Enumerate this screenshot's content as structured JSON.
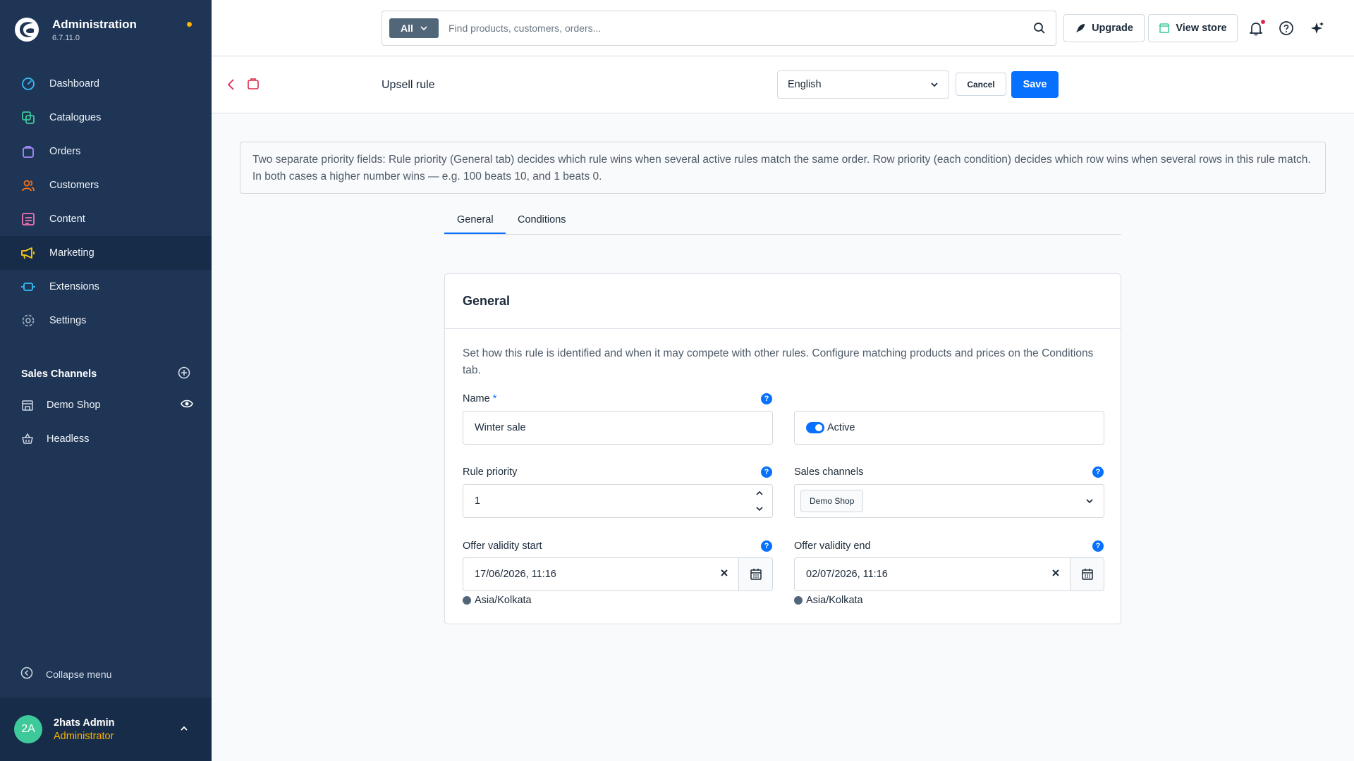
{
  "app": {
    "title": "Administration",
    "version": "6.7.11.0"
  },
  "sidebar": {
    "items": [
      {
        "label": "Dashboard",
        "icon": "dashboard-icon",
        "color": "#38bdf8"
      },
      {
        "label": "Catalogues",
        "icon": "catalogues-icon",
        "color": "#3ec99a"
      },
      {
        "label": "Orders",
        "icon": "orders-icon",
        "color": "#a78bfa"
      },
      {
        "label": "Customers",
        "icon": "customers-icon",
        "color": "#f97316"
      },
      {
        "label": "Content",
        "icon": "content-icon",
        "color": "#f472b6"
      },
      {
        "label": "Marketing",
        "icon": "marketing-icon",
        "color": "#facc15"
      },
      {
        "label": "Extensions",
        "icon": "extensions-icon",
        "color": "#38bdf8"
      },
      {
        "label": "Settings",
        "icon": "settings-icon",
        "color": "#9aa7b8"
      }
    ],
    "active": "Marketing",
    "sales_channels_title": "Sales Channels",
    "sales_channels": [
      {
        "label": "Demo Shop",
        "icon": "storefront-icon"
      },
      {
        "label": "Headless",
        "icon": "basket-icon"
      }
    ],
    "collapse_label": "Collapse menu"
  },
  "user": {
    "initials": "2A",
    "name": "2hats Admin",
    "role": "Administrator"
  },
  "topbar": {
    "search_type": "All",
    "search_placeholder": "Find products, customers, orders...",
    "upgrade_label": "Upgrade",
    "view_store_label": "View store"
  },
  "page": {
    "title": "Upsell rule",
    "language": "English",
    "cancel_label": "Cancel",
    "save_label": "Save"
  },
  "info_text": "Two separate priority fields: Rule priority (General tab) decides which rule wins when several active rules match the same order. Row priority (each condition) decides which row wins when several rows in this rule match. In both cases a higher number wins — e.g. 100 beats 10, and 1 beats 0.",
  "tabs": [
    "General",
    "Conditions"
  ],
  "active_tab": "General",
  "card": {
    "title": "General",
    "description": "Set how this rule is identified and when it may compete with other rules. Configure matching products and prices on the Conditions tab.",
    "name_label": "Name",
    "required_mark": "*",
    "name_value": "Winter sale",
    "active_label": "Active",
    "active_on": true,
    "priority_label": "Rule priority",
    "priority_value": "1",
    "channels_label": "Sales channels",
    "channels_selected": "Demo Shop",
    "start_label": "Offer validity start",
    "start_value": "17/06/2026, 11:16",
    "end_label": "Offer validity end",
    "end_value": "02/07/2026, 11:16",
    "timezone": "Asia/Kolkata",
    "help_glyph": "?"
  },
  "colors": {
    "sidebar_bg": "#1e3555",
    "sidebar_active_bg": "#172c48",
    "primary": "#0870ff",
    "user_role": "#ffb300",
    "avatar_bg": "#3ec99a"
  }
}
